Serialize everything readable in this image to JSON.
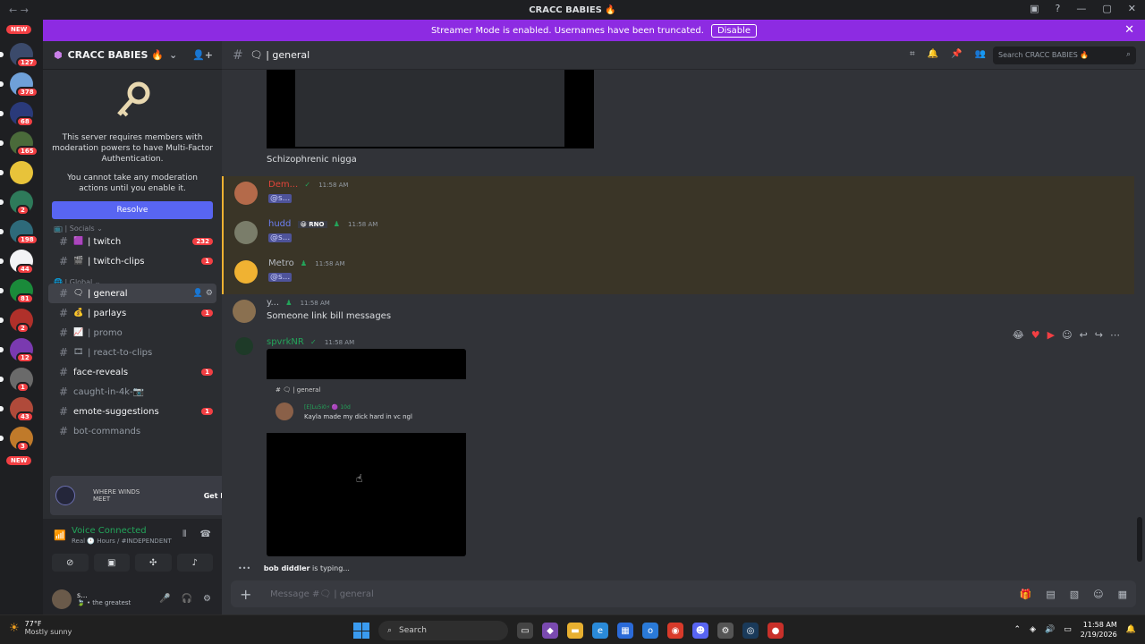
{
  "window": {
    "title": "CRACC BABIES 🔥",
    "nav": "← →",
    "controls": [
      "▣",
      "?",
      "—",
      "▢",
      "✕"
    ]
  },
  "banner": {
    "text": "Streamer Mode is enabled. Usernames have been truncated.",
    "button": "Disable"
  },
  "guilds": {
    "new_top": "NEW",
    "new_bottom": "NEW",
    "items": [
      {
        "badge": "127",
        "color": "#3b4a6b"
      },
      {
        "badge": "378",
        "color": "#6fa0d8"
      },
      {
        "badge": "68",
        "color": "#2a3a7a"
      },
      {
        "badge": "165",
        "color": "#4a6a3a"
      },
      {
        "badge": "",
        "color": "#e8c33a"
      },
      {
        "badge": "2",
        "color": "#2e7a5a"
      },
      {
        "badge": "198",
        "color": "#2e6a7a"
      },
      {
        "badge": "44",
        "color": "#f2f3f5"
      },
      {
        "badge": "81",
        "color": "#1a8a3a"
      },
      {
        "badge": "2",
        "color": "#b0302a"
      },
      {
        "badge": "12",
        "color": "#7a3ab0"
      },
      {
        "badge": "1",
        "color": "#6a6a6a"
      },
      {
        "badge": "43",
        "color": "#b04a3a"
      },
      {
        "badge": "3",
        "color": "#c07a2a"
      }
    ]
  },
  "sidebar": {
    "server_name": "CRACC BABIES 🔥",
    "mfa_notice": "This server requires members with moderation powers to have Multi-Factor Authentication.",
    "mfa_cant": "You cannot take any moderation actions until you enable it.",
    "resolve": "Resolve",
    "cat_socials": "📺 | Socials ⌄",
    "cat_global": "🌐 | Global ⌄",
    "channels_socials": [
      {
        "emoji": "🟪",
        "name": "| twitch",
        "badge": "232"
      },
      {
        "emoji": "🎬",
        "name": "| twitch-clips",
        "badge": "1"
      }
    ],
    "channels_global": [
      {
        "emoji": "🗨",
        "name": "| general",
        "badge": "",
        "active": true
      },
      {
        "emoji": "💰",
        "name": "| parlays",
        "badge": "1"
      },
      {
        "emoji": "📈",
        "name": "| promo",
        "badge": ""
      },
      {
        "emoji": "🎞",
        "name": "| react-to-clips",
        "badge": ""
      },
      {
        "emoji": "",
        "name": "face-reveals",
        "badge": "1"
      },
      {
        "emoji": "",
        "name": "caught-in-4k-📷",
        "badge": ""
      },
      {
        "emoji": "",
        "name": "emote-suggestions",
        "badge": "1"
      },
      {
        "emoji": "",
        "name": "bot-commands",
        "badge": ""
      }
    ],
    "promo": {
      "game": "WHERE WINDS MEET",
      "button": "Get Reward!"
    },
    "voice": {
      "status": "Voice Connected",
      "sub": "Real 🕛 Hours / #INDEPENDENT"
    },
    "user": {
      "name": "s...",
      "status": "🍃 • the greatest"
    }
  },
  "channel": {
    "name": "🗨 | general",
    "search_placeholder": "Search CRACC BABIES 🔥",
    "messages": [
      {
        "text": "Schizophrenic nigga"
      },
      {
        "user": "Dem...",
        "time": "11:58 AM",
        "mention": "@s...",
        "color": "#e0443a"
      },
      {
        "user": "hudd",
        "tag": "😀 RNO",
        "time": "11:58 AM",
        "mention": "@s...",
        "color": "#5865f2"
      },
      {
        "user": "Metro",
        "time": "11:58 AM",
        "mention": "@s...",
        "color": "#b5bac1"
      },
      {
        "user": "y...",
        "time": "11:58 AM",
        "text": "Someone link bill messages",
        "color": "#b5bac1"
      },
      {
        "user": "spvrkNR",
        "time": "11:58 AM",
        "color": "#23a55a"
      }
    ],
    "embed": {
      "channel": "# 🗨 | general",
      "user": "[E]Lu5i0⚡ 🟣 10d",
      "text": "Kayla made my dick hard in vc ngl"
    },
    "typing_user": "bob diddler",
    "typing_suffix": " is typing...",
    "composer_placeholder": "Message #🗨 | general"
  },
  "taskbar": {
    "temp": "77°F",
    "condition": "Mostly sunny",
    "search": "Search",
    "time": "11:58 AM",
    "date": "2/19/2026"
  }
}
